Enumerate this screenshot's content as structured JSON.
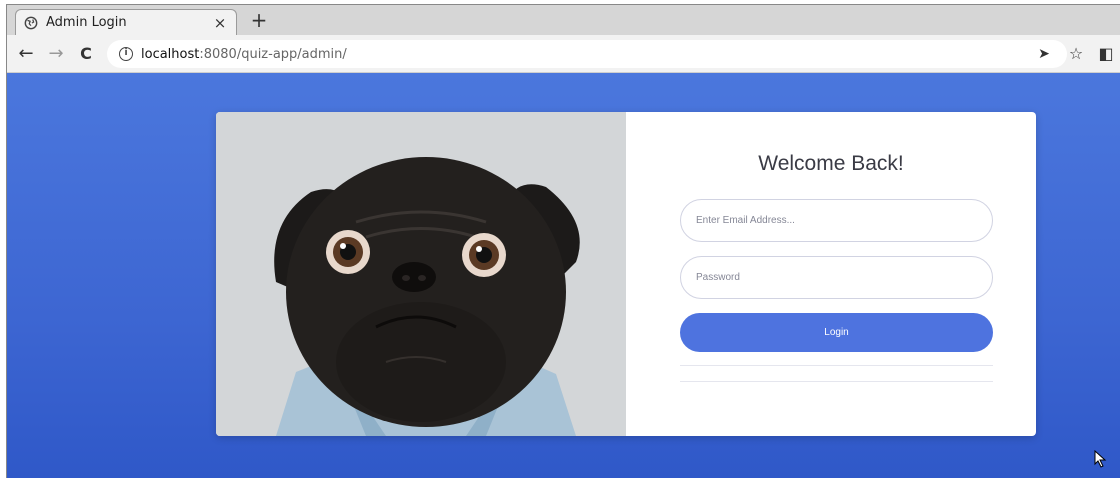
{
  "browser": {
    "tab_title": "Admin Login",
    "tab_close": "×",
    "new_tab": "+",
    "back": "←",
    "forward": "→",
    "reload": "C",
    "url_host": "localhost",
    "url_rest": ":8080/quiz-app/admin/",
    "send": "➤",
    "bookmark": "☆",
    "sidepanel": "◧"
  },
  "login": {
    "heading": "Welcome Back!",
    "email_placeholder": "Enter Email Address...",
    "password_placeholder": "Password",
    "button_label": "Login"
  },
  "colors": {
    "page_background": "#4b77dd",
    "button": "#4e73df"
  }
}
